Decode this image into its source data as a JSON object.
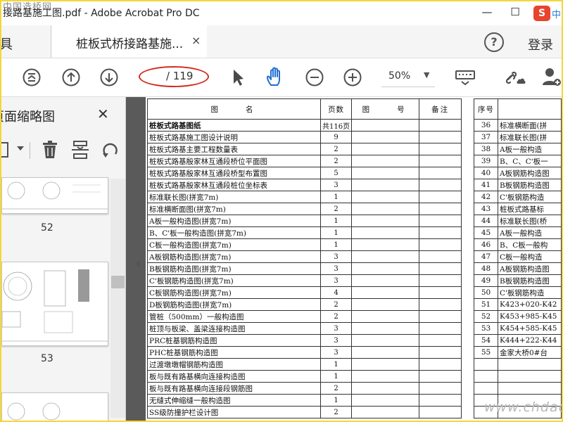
{
  "window": {
    "title": "接路基施工图.pdf - Adobe Acrobat Pro DC",
    "watermark_top": "中国造桥网",
    "controls": {
      "minimize": "—",
      "maximize": "☐",
      "close": "✕"
    },
    "ime_badge": "S",
    "ime_zh": "中"
  },
  "tabs": {
    "tools_label": "工具",
    "doc_tab_label": "桩板式桥接路基施...",
    "close": "×",
    "help": "?",
    "login": "登录"
  },
  "toolbar": {
    "page_text": "/ 119",
    "zoom": "50%",
    "zoom_caret": "▼",
    "annotation_color": "#d42a20",
    "accent_color": "#1f6fd1"
  },
  "thumbnails": {
    "panel_title": "页面缩略图",
    "close": "✕",
    "pages": [
      {
        "label": "52"
      },
      {
        "label": "53"
      }
    ]
  },
  "doc": {
    "table_left": {
      "headers": [
        "图　　名",
        "页数",
        "图　　号",
        "备注"
      ],
      "rows": [
        {
          "name": "桩板式路基图纸",
          "pages": "共116页",
          "bold": true
        },
        {
          "name": "桩板式路基施工图设计说明",
          "pages": "9"
        },
        {
          "name": "桩板式路基主要工程数量表",
          "pages": "2"
        },
        {
          "name": "桩板式路基殷家林互通段桥位平面图",
          "pages": "2"
        },
        {
          "name": "桩板式路基殷家林互通段桥型布置图",
          "pages": "5"
        },
        {
          "name": "桩板式路基殷家林互通段桩位坐标表",
          "pages": "3"
        },
        {
          "name": "标准联长图(拼宽7m)",
          "pages": "1"
        },
        {
          "name": "标准横断面图(拼宽7m)",
          "pages": "2"
        },
        {
          "name": "A板一般构造图(拼宽7m)",
          "pages": "1"
        },
        {
          "name": "B、C'板一般构造图(拼宽7m)",
          "pages": "1"
        },
        {
          "name": "C板一般构造图(拼宽7m)",
          "pages": "1"
        },
        {
          "name": "A板钢筋构造图(拼宽7m)",
          "pages": "3"
        },
        {
          "name": "B板钢筋构造图(拼宽7m)",
          "pages": "3"
        },
        {
          "name": "C'板钢筋构造图(拼宽7m)",
          "pages": "3"
        },
        {
          "name": "C板钢筋构造图(拼宽7m)",
          "pages": "4"
        },
        {
          "name": "D板钢筋构造图(拼宽7m)",
          "pages": "2"
        },
        {
          "name": "管桩（500mm）一般构造图",
          "pages": "2"
        },
        {
          "name": "桩顶与板梁、盖梁连接构造图",
          "pages": "3"
        },
        {
          "name": "PRC桩基钢筋构造图",
          "pages": "3"
        },
        {
          "name": "PHC桩基钢筋构造图",
          "pages": "3"
        },
        {
          "name": "过渡墩墩帽钢筋构造图",
          "pages": "1"
        },
        {
          "name": "板与既有路基横向连接构造图",
          "pages": "1"
        },
        {
          "name": "板与既有路基横向连接段钢筋图",
          "pages": "2"
        },
        {
          "name": "无缝式伸缩缝一般构造图",
          "pages": "1"
        },
        {
          "name": "SS级防撞护栏设计图",
          "pages": "2"
        }
      ]
    },
    "table_right": {
      "header": "序号",
      "rows": [
        {
          "no": "36",
          "name": "标准横断面(拼"
        },
        {
          "no": "37",
          "name": "标准联长图(拼"
        },
        {
          "no": "38",
          "name": "A板一般构造"
        },
        {
          "no": "39",
          "name": "B、C、C'板一"
        },
        {
          "no": "40",
          "name": "A板钢筋构造图"
        },
        {
          "no": "41",
          "name": "B板钢筋构造图"
        },
        {
          "no": "42",
          "name": "C'板钢筋构造"
        },
        {
          "no": "43",
          "name": "桩板式路基标"
        },
        {
          "no": "44",
          "name": "标准联长图(桥"
        },
        {
          "no": "45",
          "name": "A板一般构造"
        },
        {
          "no": "46",
          "name": "B、C板一般构"
        },
        {
          "no": "47",
          "name": "C板一般构造"
        },
        {
          "no": "48",
          "name": "A板钢筋构造图"
        },
        {
          "no": "49",
          "name": "B板钢筋构造图"
        },
        {
          "no": "50",
          "name": "C'板钢筋构造"
        },
        {
          "no": "51",
          "name": "K423+020-K42"
        },
        {
          "no": "52",
          "name": "K453+985-K45"
        },
        {
          "no": "53",
          "name": "K454+585-K45"
        },
        {
          "no": "54",
          "name": "K444+222-K44"
        },
        {
          "no": "55",
          "name": "金家大桥0#台"
        },
        {
          "no": "",
          "name": ""
        },
        {
          "no": "",
          "name": ""
        },
        {
          "no": "",
          "name": ""
        },
        {
          "no": "",
          "name": ""
        },
        {
          "no": "",
          "name": ""
        }
      ]
    },
    "watermark_bottom": "www.chdao.com"
  }
}
